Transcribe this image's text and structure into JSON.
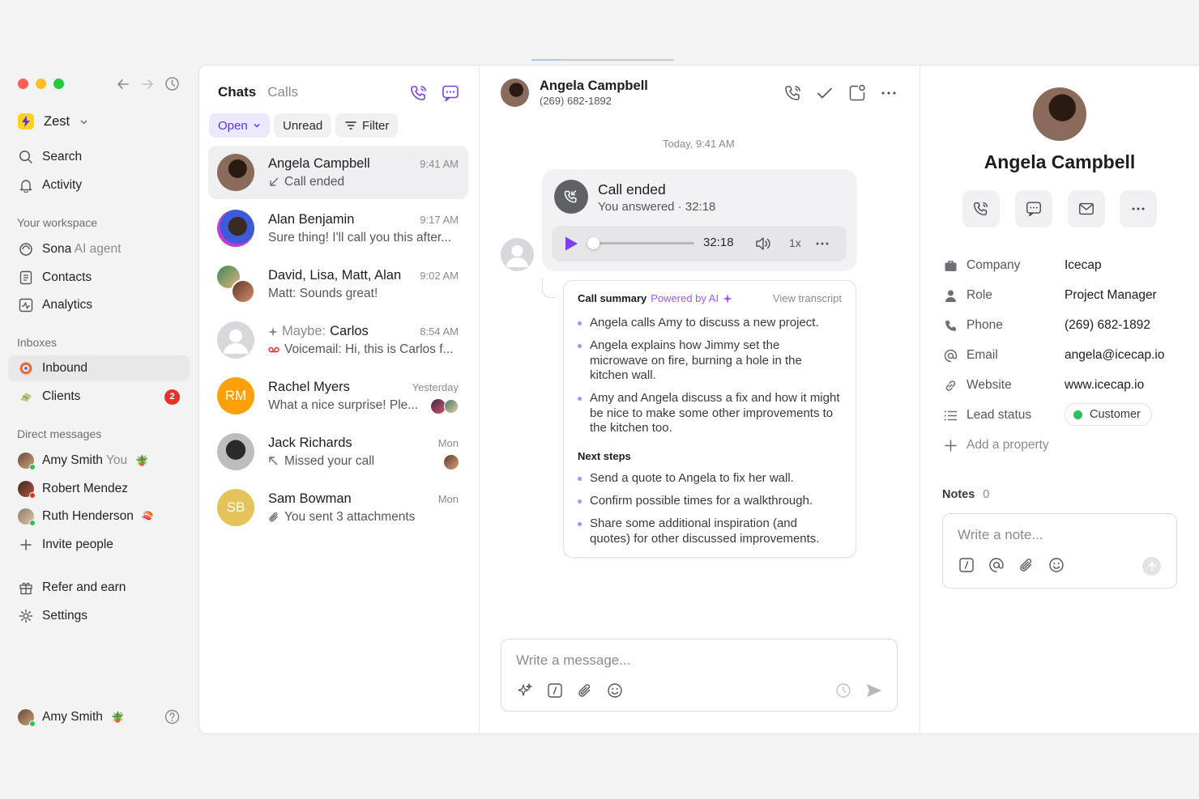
{
  "window": {
    "traffic_lights": [
      "#ff5f57",
      "#febc2e",
      "#28c840"
    ]
  },
  "nav": {
    "back_icon": "arrow-left-icon",
    "forward_icon": "arrow-right-icon",
    "history_icon": "clock-icon"
  },
  "workspace": {
    "name": "Zest"
  },
  "sidebar": {
    "search": "Search",
    "activity": "Activity",
    "your_workspace_heading": "Your workspace",
    "sona_label": "Sona",
    "sona_suffix": "AI agent",
    "contacts": "Contacts",
    "analytics": "Analytics",
    "inboxes_heading": "Inboxes",
    "inbound": "Inbound",
    "clients": "Clients",
    "clients_badge": "2",
    "dm_heading": "Direct messages",
    "dms": [
      {
        "name": "Amy Smith",
        "suffix": "You"
      },
      {
        "name": "Robert Mendez"
      },
      {
        "name": "Ruth Henderson"
      }
    ],
    "invite": "Invite people",
    "refer": "Refer and earn",
    "settings": "Settings",
    "current_user": "Amy Smith"
  },
  "chatlist": {
    "tab_chats": "Chats",
    "tab_calls": "Calls",
    "filter_open": "Open",
    "filter_unread": "Unread",
    "filter_label": "Filter",
    "rows": [
      {
        "name": "Angela Campbell",
        "time": "9:41 AM",
        "preview": "Call ended"
      },
      {
        "name": "Alan Benjamin",
        "time": "9:17 AM",
        "preview": "Sure thing! I'll call you this after..."
      },
      {
        "name": "David, Lisa, Matt, Alan",
        "time": "9:02 AM",
        "preview": "Matt: Sounds great!"
      },
      {
        "name_prefix": "Maybe:",
        "name": "Carlos",
        "time": "8:54 AM",
        "preview": "Voicemail: Hi, this is Carlos f..."
      },
      {
        "name": "Rachel Myers",
        "time": "Yesterday",
        "preview": "What a nice surprise! Ple...",
        "initials": "RM"
      },
      {
        "name": "Jack Richards",
        "time": "Mon",
        "preview": "Missed your call"
      },
      {
        "name": "Sam Bowman",
        "time": "Mon",
        "preview": "You sent 3 attachments",
        "initials": "SB"
      }
    ]
  },
  "conversation": {
    "contact_name": "Angela Campbell",
    "contact_phone": "(269) 682-1892",
    "date_separator": "Today, 9:41 AM",
    "call_title": "Call ended",
    "call_subtitle": "You answered · 32:18",
    "duration": "32:18",
    "speed": "1x",
    "playback_progress": 0.0,
    "summary_title": "Call summary",
    "summary_powered": "Powered by AI",
    "view_transcript": "View transcript",
    "summary_points": [
      "Angela calls Amy to discuss a new project.",
      "Angela explains how Jimmy set the microwave on fire, burning a hole in the kitchen wall.",
      "Amy and Angela discuss a fix and how it might be nice to make some other improvements to the kitchen too."
    ],
    "next_steps_title": "Next steps",
    "next_steps": [
      "Send a quote to Angela to fix her wall.",
      "Confirm possible times for a walkthrough.",
      "Share some additional inspiration (and quotes) for other discussed improvements."
    ],
    "composer_placeholder": "Write a message..."
  },
  "contact": {
    "name": "Angela Campbell",
    "properties": [
      {
        "label": "Company",
        "value": "Icecap",
        "icon": "briefcase-icon"
      },
      {
        "label": "Role",
        "value": "Project Manager",
        "icon": "person-icon"
      },
      {
        "label": "Phone",
        "value": "(269) 682-1892",
        "icon": "phone-icon"
      },
      {
        "label": "Email",
        "value": "angela@icecap.io",
        "icon": "at-icon"
      },
      {
        "label": "Website",
        "value": "www.icecap.io",
        "icon": "link-icon"
      },
      {
        "label": "Lead status",
        "value": "Customer",
        "icon": "list-icon"
      }
    ],
    "add_property": "Add a property",
    "notes_label": "Notes",
    "notes_count": "0",
    "note_placeholder": "Write a note..."
  },
  "colors": {
    "accent": "#7b3ff2",
    "badge": "#e5322d",
    "status_green": "#27c05b"
  }
}
